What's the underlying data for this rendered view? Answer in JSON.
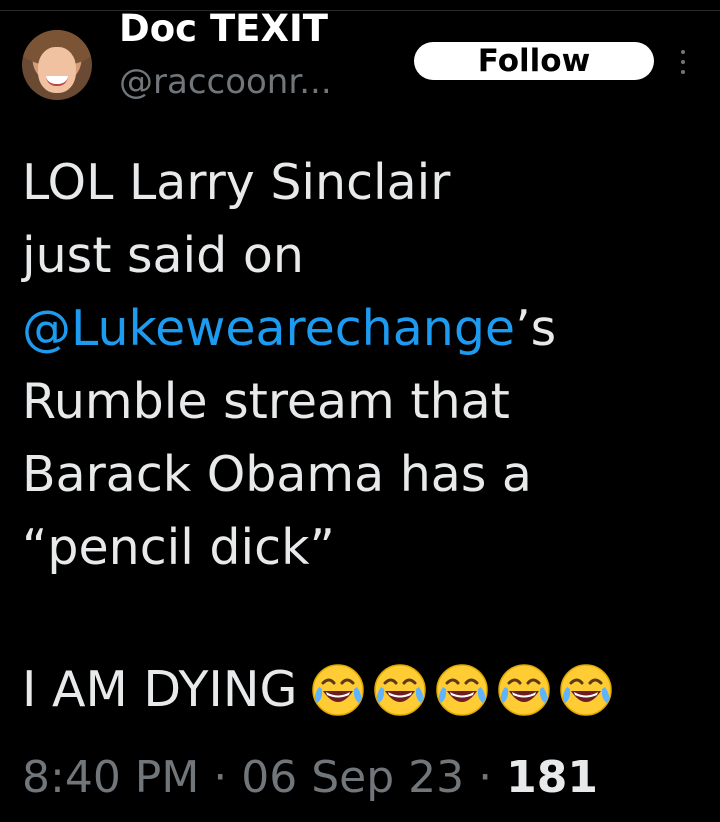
{
  "author": {
    "display_name": "Doc TEXIT",
    "handle": "@raccoonr..."
  },
  "actions": {
    "follow_label": "Follow"
  },
  "tweet": {
    "text_before_mention": "LOL Larry Sinclair\njust said on\n",
    "mention": "@Lukewearechange",
    "text_after_mention": "’s\nRumble stream that\nBarack Obama has a\n“pencil dick”",
    "closing_line": "I AM DYING",
    "emoji_count": 5,
    "emoji_name": "face-with-tears-of-joy-icon"
  },
  "meta": {
    "time": "8:40 PM",
    "sep1": " · ",
    "date": "06 Sep 23",
    "sep2": " · ",
    "views": "181"
  },
  "colors": {
    "background": "#000000",
    "text": "#e7e9ea",
    "secondary": "#71767b",
    "link": "#1d9bf0"
  }
}
